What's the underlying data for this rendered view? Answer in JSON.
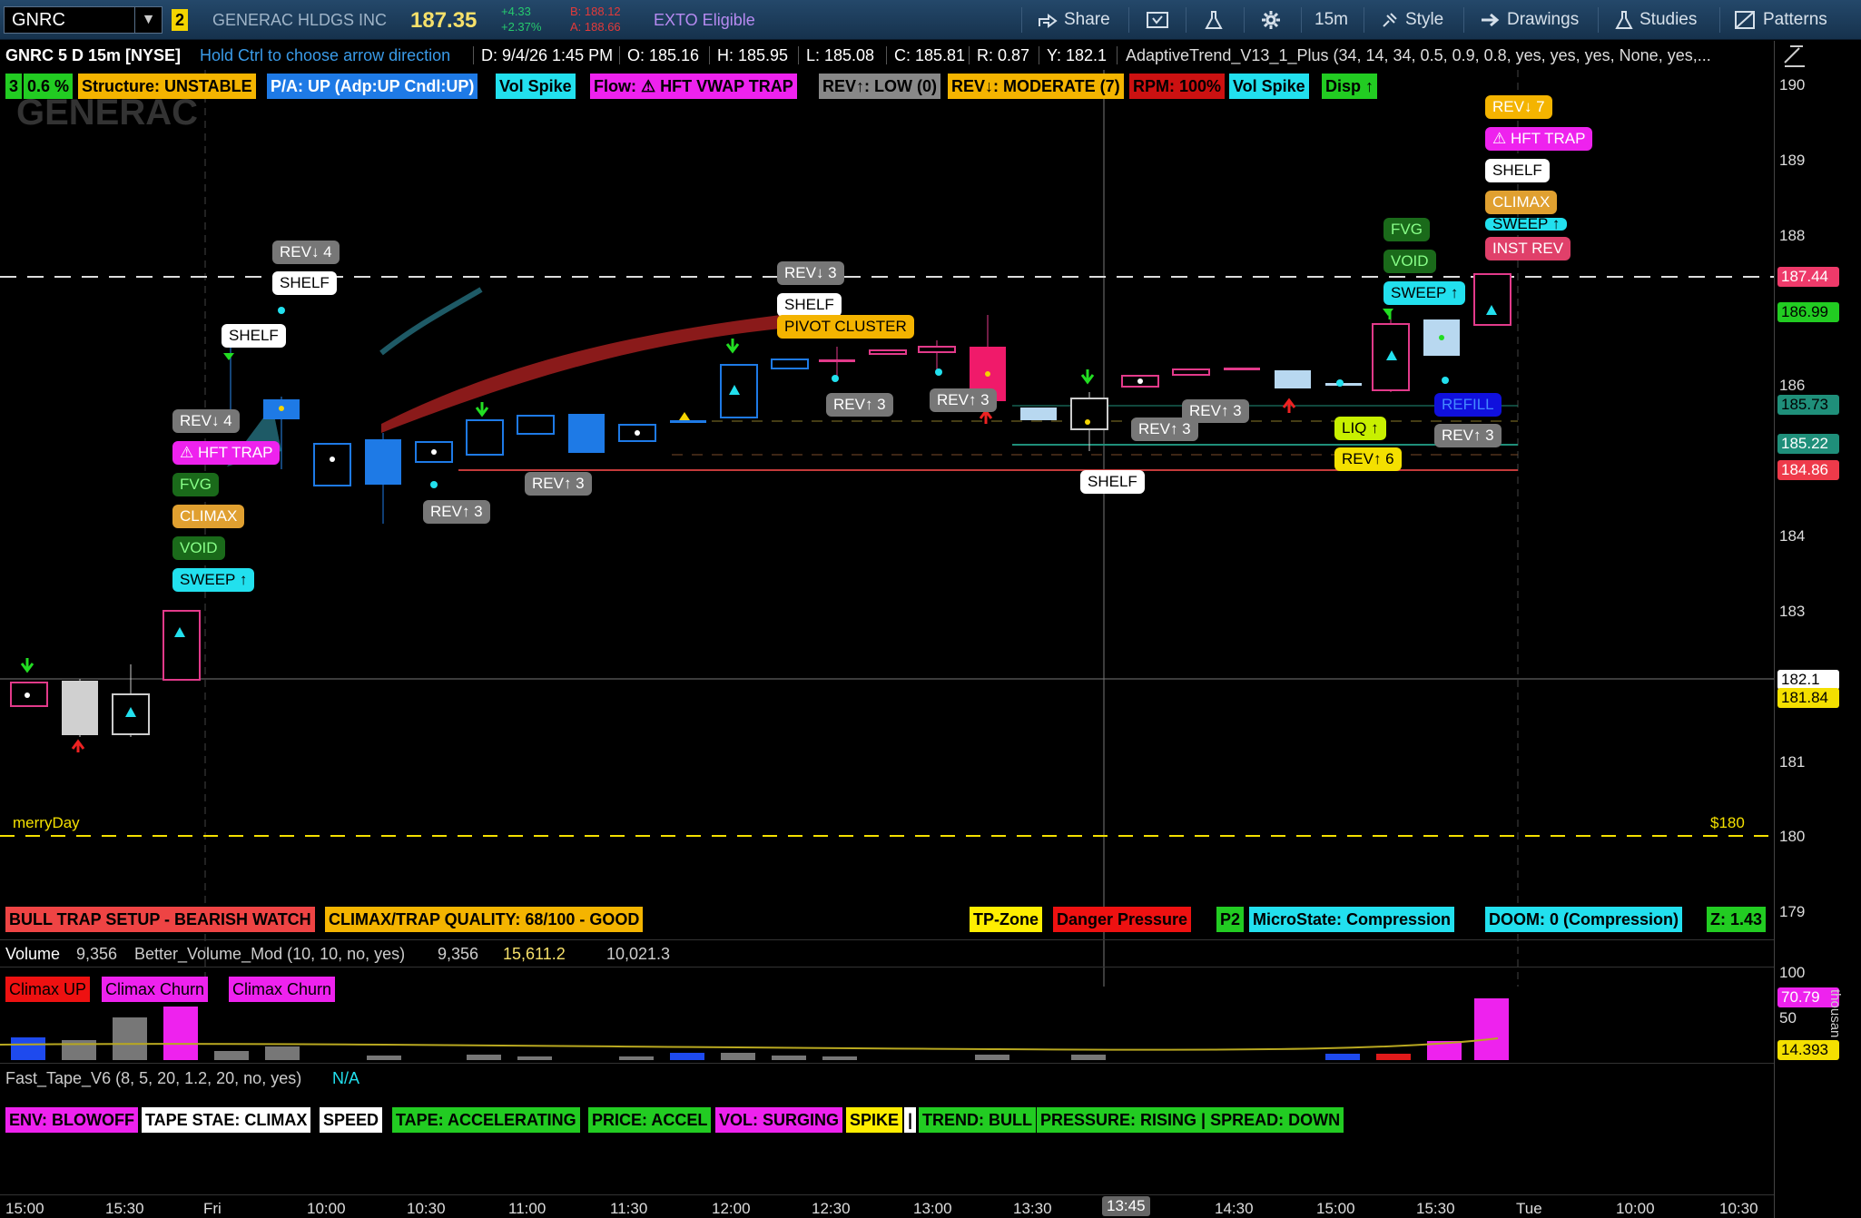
{
  "toolbar": {
    "symbol": "GNRC",
    "link_badge": "2",
    "company": "GENERAC HLDGS INC",
    "last_price": "187.35",
    "change_abs": "+4.33",
    "change_pct": "+2.37%",
    "bid": "B: 188.12",
    "ask": "A: 188.66",
    "extended": "EXTO Eligible",
    "share": "Share",
    "timeframe": "15m",
    "style": "Style",
    "drawings": "Drawings",
    "studies": "Studies",
    "patterns": "Patterns"
  },
  "info": {
    "title": "GNRC 5 D 15m [NYSE]",
    "hint": "Hold Ctrl to choose arrow direction",
    "date": "D: 9/4/26 1:45 PM",
    "open": "O: 185.16",
    "high": "H: 185.95",
    "low": "L: 185.08",
    "close": "C: 185.81",
    "range": "R: 0.87",
    "y": "Y: 182.1",
    "study": "AdaptiveTrend_V13_1_Plus (34, 14, 34, 0.5, 0.9, 0.8, yes, yes, yes, None, yes,..."
  },
  "top_labels": [
    {
      "text": "3",
      "bg": "#22cc22",
      "fg": "#000"
    },
    {
      "text": "0.6 %",
      "bg": "#22cc22",
      "fg": "#000"
    },
    {
      "text": "Structure: UNSTABLE",
      "bg": "#f4b400",
      "fg": "#000"
    },
    {
      "text": "P/A: UP  (Adp:UP  Cndl:UP)",
      "bg": "#1e7ae6",
      "fg": "#fff"
    },
    {
      "text": "Vol Spike",
      "bg": "#22e0ee",
      "fg": "#000"
    },
    {
      "text": "Flow: ⚠ HFT VWAP TRAP",
      "bg": "#ee22ee",
      "fg": "#000"
    },
    {
      "text": "REV↑: LOW (0)",
      "bg": "#888888",
      "fg": "#000"
    },
    {
      "text": "REV↓: MODERATE (7)",
      "bg": "#f4b400",
      "fg": "#000"
    },
    {
      "text": "RPM: 100%",
      "bg": "#cc1111",
      "fg": "#000"
    },
    {
      "text": "Vol Spike",
      "bg": "#22e0ee",
      "fg": "#000"
    },
    {
      "text": "Disp ↑",
      "bg": "#22cc22",
      "fg": "#000"
    }
  ],
  "watermark": "GENERAC",
  "chart_labels": {
    "rev_d4_a": "REV↓ 4",
    "shelf_a": "SHELF",
    "shelf_b": "SHELF",
    "rev_d4_b": "REV↓ 4",
    "hft_a": "⚠ HFT TRAP",
    "fvg_a": "FVG",
    "climax_a": "CLIMAX",
    "void_a": "VOID",
    "sweep_a": "SWEEP ↑",
    "rev_u3_a": "REV↑ 3",
    "rev_u3_b": "REV↑ 3",
    "rev_d3_c": "REV↓ 3",
    "shelf_c": "SHELF",
    "pivot": "PIVOT CLUSTER",
    "rev_u3_d": "REV↑ 3",
    "rev_u3_e": "REV↑ 3",
    "rev_u3_f": "REV↑ 3",
    "rev_u3_g": "REV↑ 3",
    "shelf_d": "SHELF",
    "liq": "LIQ ↑",
    "rev_u6": "REV↑ 6",
    "fvg_b": "FVG",
    "void_b": "VOID",
    "sweep_b": "SWEEP ↑",
    "refill": "REFILL",
    "rev_u3_h": "REV↑ 3",
    "rev_d7": "REV↓ 7",
    "hft_b": "⚠ HFT TRAP",
    "shelf_e": "SHELF",
    "climax_b": "CLIMAX",
    "sweep_c": "SWEEP ↑",
    "inst_rev": "INST REV",
    "merry": "merryDay",
    "dollar": "$180"
  },
  "bottom_left": [
    {
      "text": "BULL TRAP SETUP - BEARISH WATCH",
      "bg": "#ee4444",
      "fg": "#000"
    },
    {
      "text": "CLIMAX/TRAP QUALITY: 68/100 - GOOD",
      "bg": "#f4b400",
      "fg": "#000"
    }
  ],
  "bottom_right": [
    {
      "text": "TP-Zone",
      "bg": "#ffee00",
      "fg": "#000"
    },
    {
      "text": "Danger Pressure",
      "bg": "#ee1111",
      "fg": "#000"
    },
    {
      "text": "P2",
      "bg": "#22cc22",
      "fg": "#000"
    },
    {
      "text": "MicroState: Compression",
      "bg": "#22e0ee",
      "fg": "#000"
    },
    {
      "text": "DOOM: 0 (Compression)",
      "bg": "#22e0ee",
      "fg": "#000"
    },
    {
      "text": "Z: 1.43",
      "bg": "#22cc22",
      "fg": "#000"
    }
  ],
  "volume": {
    "title": "Volume",
    "v1": "9,356",
    "study": "Better_Volume_Mod (10, 10, no, yes)",
    "v2": "9,356",
    "v3": "15,611.2",
    "v4": "10,021.3",
    "labels": [
      {
        "text": "Climax UP",
        "bg": "#ee1111",
        "fg": "#000"
      },
      {
        "text": "Climax Churn",
        "bg": "#ee22ee",
        "fg": "#000"
      },
      {
        "text": "Climax Churn",
        "bg": "#ee22ee",
        "fg": "#000"
      }
    ],
    "axis": [
      "100",
      "50"
    ],
    "unit": "thousan"
  },
  "tape": {
    "study": "Fast_Tape_V6 (8, 5, 20, 1.2, 20, no, yes)",
    "na": "N/A",
    "labels": [
      {
        "text": "ENV: BLOWOFF",
        "bg": "#ee22ee",
        "fg": "#000"
      },
      {
        "text": "TAPE STAE: CLIMAX",
        "bg": "#ffffff",
        "fg": "#000"
      },
      {
        "text": "SPEED",
        "bg": "#ffffff",
        "fg": "#000"
      },
      {
        "text": "TAPE: ACCELERATING",
        "bg": "#22cc22",
        "fg": "#000"
      },
      {
        "text": "PRICE: ACCEL",
        "bg": "#22cc22",
        "fg": "#000"
      },
      {
        "text": "VOL: SURGING",
        "bg": "#ee22ee",
        "fg": "#000"
      },
      {
        "text": "SPIKE",
        "bg": "#ffee00",
        "fg": "#000"
      },
      {
        "text": "|",
        "bg": "#ffffff",
        "fg": "#000"
      },
      {
        "text": "TREND: BULL",
        "bg": "#22cc22",
        "fg": "#000"
      },
      {
        "text": "PRESSURE: RISING | SPREAD: DOWN",
        "bg": "#22cc22",
        "fg": "#000"
      }
    ]
  },
  "y_axis": [
    "190",
    "189",
    "188",
    "186",
    "184",
    "183",
    "181",
    "180",
    "179"
  ],
  "price_boxes": [
    {
      "text": "187.44",
      "bg": "#ee3a6a",
      "fg": "#fff"
    },
    {
      "text": "186.99",
      "bg": "#22cc22",
      "fg": "#000"
    },
    {
      "text": "185.73",
      "bg": "#1f8f7a",
      "fg": "#000"
    },
    {
      "text": "185.22",
      "bg": "#1f8f7a",
      "fg": "#fff"
    },
    {
      "text": "184.86",
      "bg": "#ee3a4a",
      "fg": "#fff"
    },
    {
      "text": "182.1",
      "bg": "#ffffff",
      "fg": "#000"
    },
    {
      "text": "181.84",
      "bg": "#f4e000",
      "fg": "#000"
    },
    {
      "text": "70.79",
      "bg": "#ee22ee",
      "fg": "#fff"
    },
    {
      "text": "14.393",
      "bg": "#f4e000",
      "fg": "#000"
    }
  ],
  "x_axis": [
    "15:00",
    "15:30",
    "Fri",
    "10:00",
    "10:30",
    "11:00",
    "11:30",
    "12:00",
    "12:30",
    "13:00",
    "13:30",
    "13:45",
    "14:30",
    "15:00",
    "15:30",
    "Tue",
    "10:00",
    "10:30"
  ]
}
